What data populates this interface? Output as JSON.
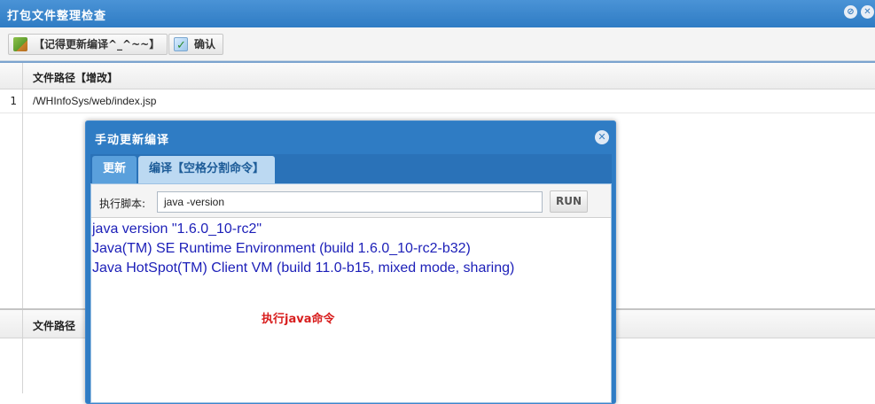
{
  "window": {
    "title": "打包文件整理检查"
  },
  "toolbar": {
    "record_button": "【记得更新编译^_^~~】",
    "confirm_button": "确认"
  },
  "grid": {
    "column_header": "文件路径【增改】",
    "rows": [
      {
        "num": "1",
        "path": "/WHInfoSys/web/index.jsp"
      }
    ]
  },
  "grid2": {
    "column_header": "文件路径"
  },
  "dialog": {
    "title": "手动更新编译",
    "tabs": [
      {
        "label": "更新",
        "active": false
      },
      {
        "label": "编译【空格分割命令】",
        "active": true
      }
    ],
    "script_label": "执行脚本:",
    "script_value": "java -version",
    "run_button": "RUN",
    "output_lines": [
      "java version \"1.6.0_10-rc2\"",
      "Java(TM) SE Runtime Environment (build 1.6.0_10-rc2-b32)",
      "Java HotSpot(TM) Client VM (build 11.0-b15, mixed mode, sharing)"
    ]
  },
  "annotation": "执行java命令",
  "colors": {
    "titlebar": "#2f7cc4",
    "output_text": "#1c1fb8",
    "annotation": "#d81e1e"
  },
  "icons": {
    "titlebar_left": "gear-icon",
    "titlebar_right": "close-icon",
    "record": "package-icon",
    "confirm": "check-icon",
    "dialog_close": "close-icon"
  }
}
